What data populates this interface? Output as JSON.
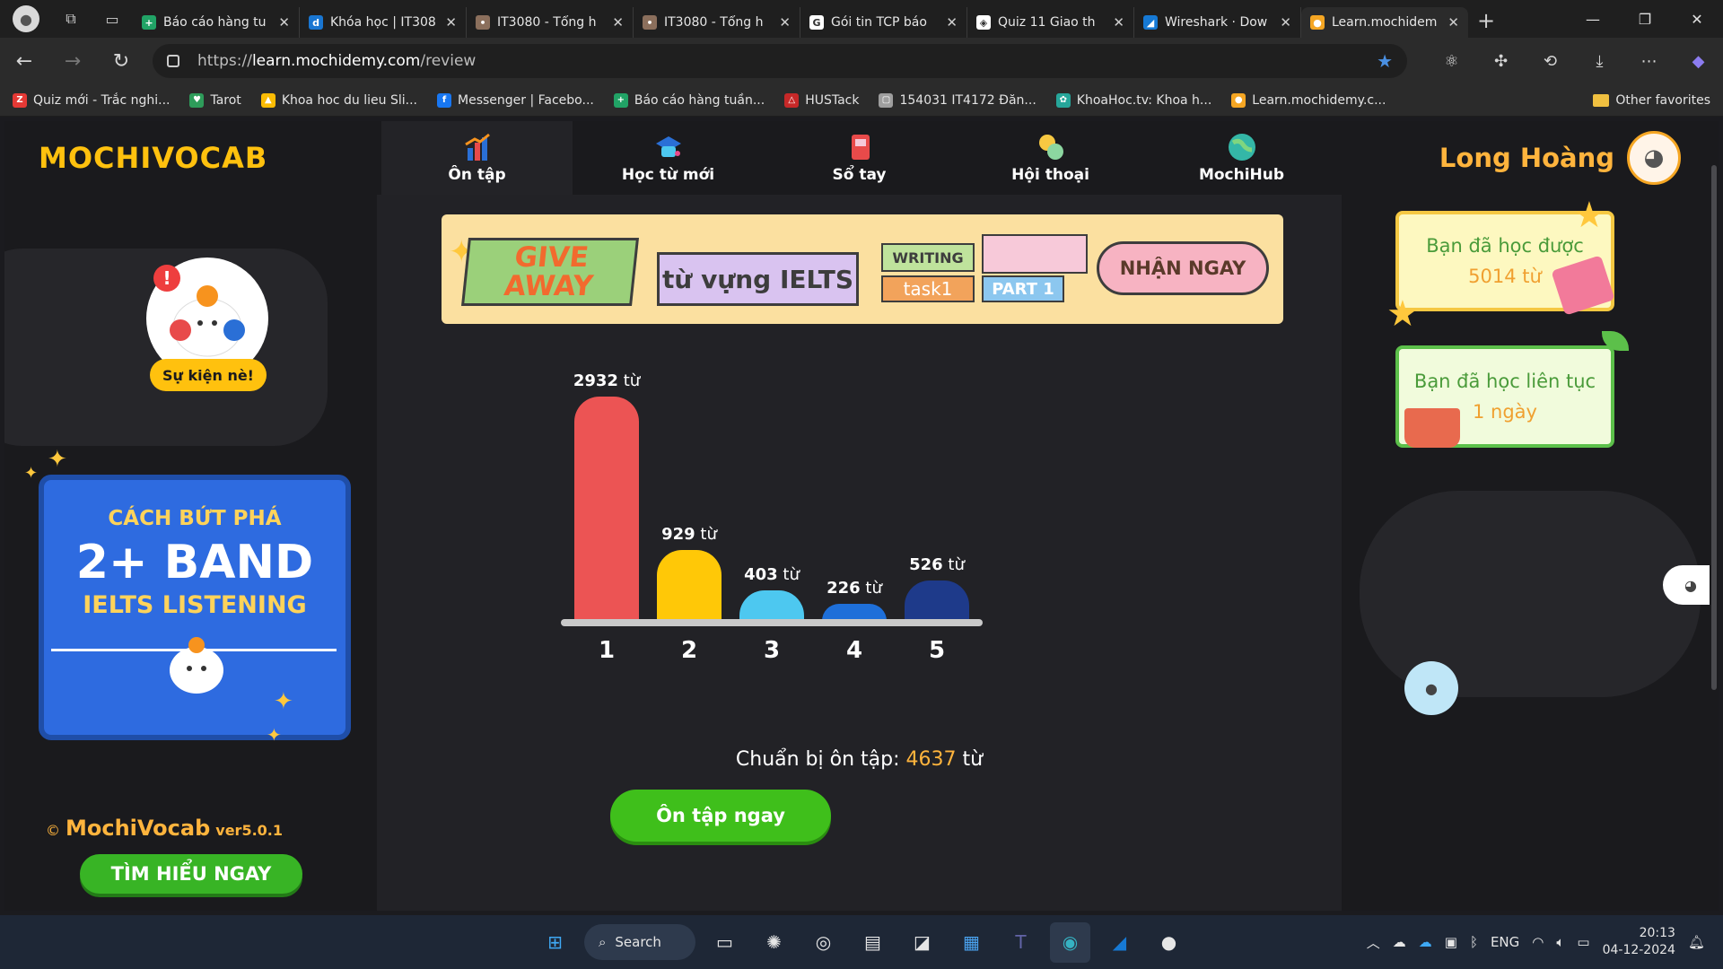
{
  "browser": {
    "tabs": [
      {
        "label": "Báo cáo hàng tu",
        "fav_color": "#21a366",
        "fav_glyph": "+"
      },
      {
        "label": "Khóa học | IT308",
        "fav_color": "#1976d2",
        "fav_glyph": "d"
      },
      {
        "label": "IT3080 - Tổng h",
        "fav_color": "#8b6f5c",
        "fav_glyph": "•"
      },
      {
        "label": "IT3080 - Tổng h",
        "fav_color": "#8b6f5c",
        "fav_glyph": "•"
      },
      {
        "label": "Gói tin TCP báo",
        "fav_color": "#ffffff",
        "fav_glyph": "G"
      },
      {
        "label": "Quiz 11 Giao th",
        "fav_color": "#ffffff",
        "fav_glyph": "◈"
      },
      {
        "label": "Wireshark · Dow",
        "fav_color": "#1679d4",
        "fav_glyph": "◢"
      },
      {
        "label": "Learn.mochidem",
        "fav_color": "#f5a623",
        "fav_glyph": "●"
      }
    ],
    "url_prefix": "https://",
    "url_host": "learn.mochidemy.com",
    "url_path": "/review",
    "bookmarks": [
      {
        "label": "Quiz mới - Trắc nghi...",
        "color": "#e53935",
        "glyph": "Z"
      },
      {
        "label": "Tarot",
        "color": "#2e9c5a",
        "glyph": "♥"
      },
      {
        "label": "Khoa hoc du lieu Sli...",
        "color": "#fbbc04",
        "glyph": "▲"
      },
      {
        "label": "Messenger | Facebo...",
        "color": "#1877f2",
        "glyph": "f"
      },
      {
        "label": "Báo cáo hàng tuần...",
        "color": "#21a366",
        "glyph": "+"
      },
      {
        "label": "HUSTack",
        "color": "#c62828",
        "glyph": "△"
      },
      {
        "label": "154031 IT4172 Đăn...",
        "color": "#9e9e9e",
        "glyph": "▢"
      },
      {
        "label": "KhoaHoc.tv: Khoa h...",
        "color": "#26a69a",
        "glyph": "✿"
      },
      {
        "label": "Learn.mochidemy.c...",
        "color": "#f5a623",
        "glyph": "●"
      }
    ],
    "other_favorites": "Other favorites"
  },
  "app": {
    "logo": "MOCHIVOCAB",
    "nav": [
      {
        "label": "Ôn tập",
        "icon": "chart-bars-icon",
        "active": true
      },
      {
        "label": "Học từ mới",
        "icon": "graduation-cap-icon",
        "active": false
      },
      {
        "label": "Sổ tay",
        "icon": "notebook-icon",
        "active": false
      },
      {
        "label": "Hội thoại",
        "icon": "conversation-icon",
        "active": false
      },
      {
        "label": "MochiHub",
        "icon": "globe-icon",
        "active": false
      }
    ],
    "user_name": "Long Hoàng"
  },
  "left": {
    "event_label": "Sự kiện nè!",
    "promo": {
      "line1": "CÁCH BỨT PHÁ",
      "line2": "2+ BAND",
      "line3": "IELTS LISTENING",
      "button": "TÌM HIỂU NGAY"
    },
    "copyright_symbol": "©",
    "copyright_brand": "MochiVocab",
    "version": "ver5.0.1"
  },
  "banner": {
    "give": "GIVE",
    "away": "AWAY",
    "vocab": "từ vựng IELTS",
    "writing": "WRITING",
    "task": "task1",
    "part": "PART 1",
    "claim": "NHẬN NGAY"
  },
  "chart_data": {
    "type": "bar",
    "categories": [
      "1",
      "2",
      "3",
      "4",
      "5"
    ],
    "values": [
      2932,
      929,
      403,
      226,
      526
    ],
    "unit": "từ",
    "colors": [
      "#ec5454",
      "#ffc807",
      "#4dc8f0",
      "#1e6fd9",
      "#1e3a8a"
    ]
  },
  "review": {
    "prep_label": "Chuẩn bị ôn tập:",
    "prep_count": "4637",
    "prep_unit": "từ",
    "button": "Ôn tập ngay"
  },
  "right": {
    "learned_label": "Bạn đã học được",
    "learned_value": "5014 từ",
    "streak_label": "Bạn đã học liên tục",
    "streak_value": "1 ngày"
  },
  "taskbar": {
    "search": "Search",
    "lang": "ENG",
    "time": "20:13",
    "date": "04-12-2024"
  }
}
